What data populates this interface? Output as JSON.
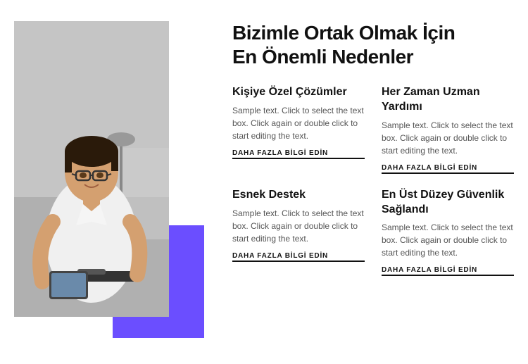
{
  "header": {
    "title_line1": "Bizimle Ortak Olmak İçin",
    "title_line2": "En Önemli Nedenler"
  },
  "features": [
    {
      "id": "feature-1",
      "title": "Kişiye Özel Çözümler",
      "text": "Sample text. Click to select the text box. Click again or double click to start editing the text.",
      "link": "DAHA FAZLA BİLGİ EDİN"
    },
    {
      "id": "feature-2",
      "title": "Her Zaman Uzman Yardımı",
      "text": "Sample text. Click to select the text box. Click again or double click to start editing the text.",
      "link": "DAHA FAZLA BİLGİ EDİN"
    },
    {
      "id": "feature-3",
      "title": "Esnek Destek",
      "text": "Sample text. Click to select the text box. Click again or double click to start editing the text.",
      "link": "DAHA FAZLA BİLGİ EDİN"
    },
    {
      "id": "feature-4",
      "title": "En Üst Düzey Güvenlik Sağlandı",
      "text": "Sample text. Click to select the text box. Click again or double click to start editing the text.",
      "link": "DAHA FAZLA BİLGİ EDİN"
    }
  ],
  "colors": {
    "accent": "#6B4EFF",
    "text_dark": "#111111",
    "text_muted": "#555555"
  }
}
